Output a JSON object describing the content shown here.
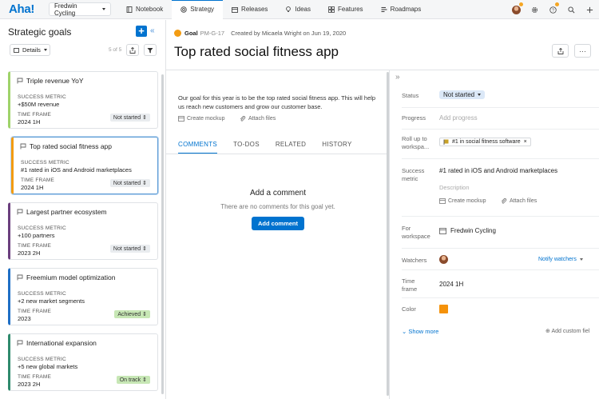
{
  "nav": {
    "logo": "Aha!",
    "workspace": "Fredwin Cycling",
    "tabs": [
      {
        "label": "Notebook",
        "icon": "notebook-icon"
      },
      {
        "label": "Strategy",
        "icon": "strategy-icon"
      },
      {
        "label": "Releases",
        "icon": "releases-icon"
      },
      {
        "label": "Ideas",
        "icon": "lightbulb-icon"
      },
      {
        "label": "Features",
        "icon": "features-icon"
      },
      {
        "label": "Roadmaps",
        "icon": "roadmaps-icon"
      }
    ],
    "active_tab": "Strategy",
    "right_icons": [
      "avatar",
      "gear-icon",
      "help-icon",
      "search-icon",
      "plus-icon"
    ]
  },
  "left": {
    "title": "Strategic goals",
    "details_label": "Details",
    "count": "5 of 5",
    "cards": [
      {
        "title": "Triple revenue YoY",
        "metric_label": "SUCCESS METRIC",
        "metric": "+$50M revenue",
        "tf_label": "TIME FRAME",
        "tf": "2024 1H",
        "status": "Not started",
        "color": "#9fd36a",
        "status_type": "dropdown"
      },
      {
        "title": "Top rated social fitness app",
        "metric_label": "SUCCESS METRIC",
        "metric": "#1 rated in iOS and Android marketplaces",
        "tf_label": "TIME FRAME",
        "tf": "2024 1H",
        "status": "Not started",
        "color": "#f39c12",
        "status_type": "dropdown"
      },
      {
        "title": "Largest partner ecosystem",
        "metric_label": "SUCCESS METRIC",
        "metric": "+100 partners",
        "tf_label": "TIME FRAME",
        "tf": "2023 2H",
        "status": "Not started",
        "color": "#6b3f7e",
        "status_type": "dropdown"
      },
      {
        "title": "Freemium model optimization",
        "metric_label": "SUCCESS METRIC",
        "metric": "+2 new market segments",
        "tf_label": "TIME FRAME",
        "tf": "2023",
        "status": "Achieved",
        "color": "#1f6fc5",
        "status_type": "green"
      },
      {
        "title": "International expansion",
        "metric_label": "SUCCESS METRIC",
        "metric": "+5 new global markets",
        "tf_label": "TIME FRAME",
        "tf": "2023 2H",
        "status": "On track",
        "color": "#2f8a6d",
        "status_type": "green"
      }
    ]
  },
  "goal": {
    "type": "Goal",
    "id": "PM-G-17",
    "created": "Created by Micaela Wright on Jun 19, 2020",
    "title": "Top rated social fitness app",
    "description": "Our goal for this year is to be the top rated social fitness app. This will help us reach new customers and grow our customer base.",
    "create_mockup": "Create mockup",
    "attach_files": "Attach files"
  },
  "tabs": [
    "COMMENTS",
    "TO-DOS",
    "RELATED",
    "HISTORY"
  ],
  "comments": {
    "heading": "Add a comment",
    "empty": "There are no comments for this goal yet.",
    "button": "Add comment"
  },
  "side": {
    "status_label": "Status",
    "status": "Not started",
    "progress_label": "Progress",
    "progress_placeholder": "Add progress",
    "rollup_label": "Roll up to workspa...",
    "rollup": "#1 in social fitness software",
    "metric_label": "Success metric",
    "metric": "#1 rated in iOS and Android marketplaces",
    "metric_desc": "Description",
    "create_mockup": "Create mockup",
    "attach_files": "Attach files",
    "workspace_label": "For workspace",
    "workspace": "Fredwin Cycling",
    "watchers_label": "Watchers",
    "notify": "Notify watchers",
    "tf_label": "Time frame",
    "tf": "2024 1H",
    "color_label": "Color",
    "color": "#f5920a",
    "show_more": "Show more",
    "add_custom": "Add custom fiel"
  }
}
